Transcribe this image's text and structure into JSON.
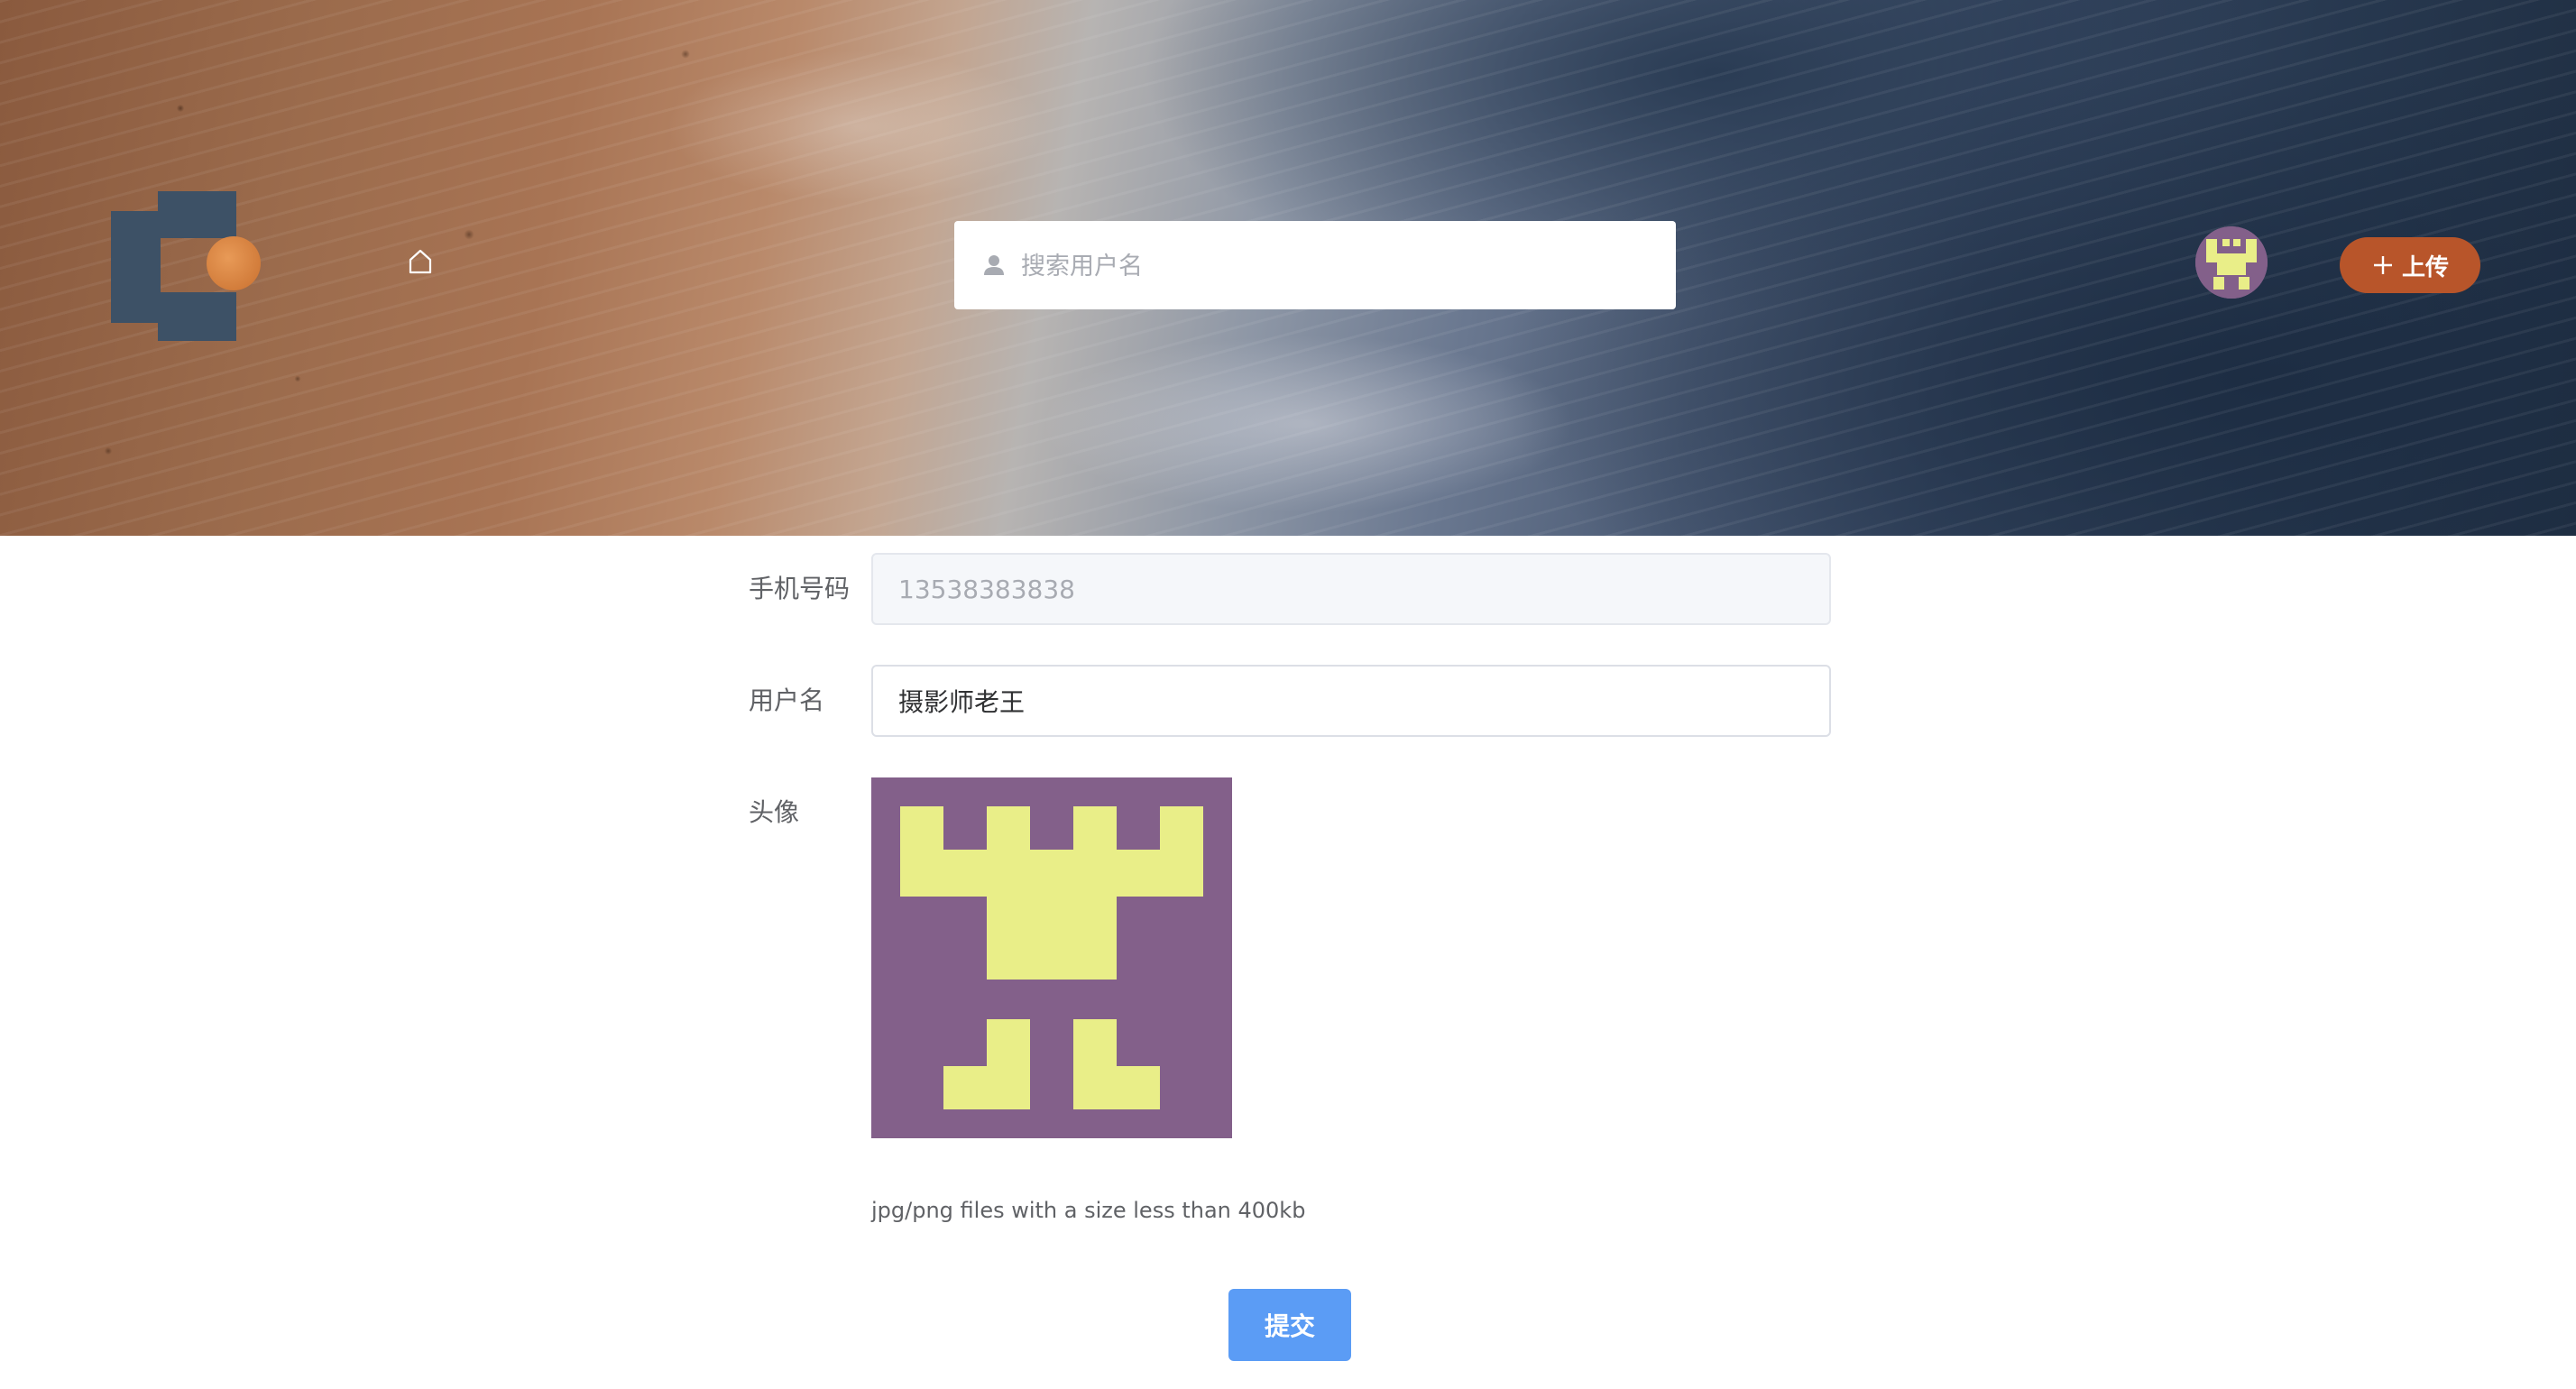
{
  "header": {
    "search_placeholder": "搜索用户名",
    "upload_label": "上传",
    "colors": {
      "upload_button": "#b8552a",
      "logo_dark": "#3d5166",
      "logo_dot": "#e08840"
    }
  },
  "form": {
    "phone": {
      "label": "手机号码",
      "value": "13538383838",
      "disabled": true
    },
    "username": {
      "label": "用户名",
      "value": "摄影师老王"
    },
    "avatar": {
      "label": "头像",
      "hint": "jpg/png files with a size less than 400kb",
      "colors": {
        "background": "#83608a",
        "figure": "#e9ee88"
      }
    },
    "submit_label": "提交",
    "colors": {
      "submit": "#5b9cf5"
    }
  },
  "icons": [
    "logo",
    "home-icon",
    "user-icon",
    "avatar",
    "plus-icon"
  ]
}
